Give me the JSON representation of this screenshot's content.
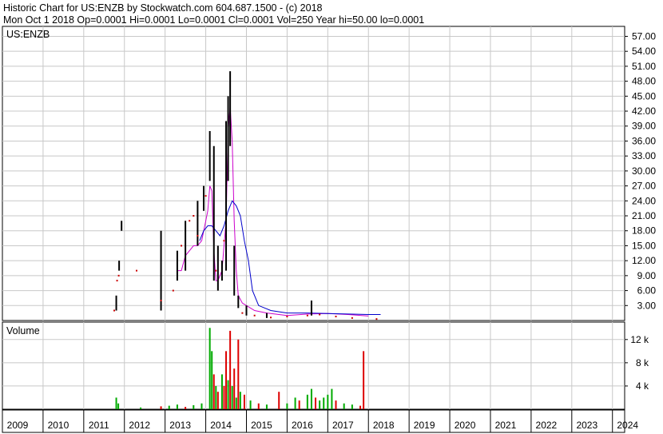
{
  "header": {
    "line1": "Historic Chart for US:ENZB by Stockwatch.com 604.687.1500 - (c) 2018",
    "line2": "Mon Oct  1 2018  Op=0.0001  Hi=0.0001  Lo=0.0001  Cl=0.0001  Vol=250  Year hi=50.00  lo=0.0001"
  },
  "colors": {
    "price_bar": "#000000",
    "up_point": "#cc0000",
    "ma_short": "#cc00cc",
    "ma_long": "#0000cc",
    "volume_up": "#00aa00",
    "volume_down": "#dd0000",
    "grid": "#c8c8c8"
  },
  "chart_data": [
    {
      "type": "line",
      "title": "US:ENZB",
      "xlabel": "",
      "ylabel": "",
      "x_ticks": [
        "2009",
        "2010",
        "2011",
        "2012",
        "2013",
        "2014",
        "2015",
        "2016",
        "2017",
        "2018",
        "2019",
        "2020",
        "2021",
        "2022",
        "2023",
        "2024"
      ],
      "y_ticks": [
        "3.00",
        "6.00",
        "9.00",
        "12.00",
        "15.00",
        "18.00",
        "21.00",
        "24.00",
        "27.00",
        "30.00",
        "33.00",
        "36.00",
        "39.00",
        "42.00",
        "45.00",
        "48.00",
        "51.00",
        "54.00",
        "57.00"
      ],
      "xlim": [
        2009.0,
        2024.3
      ],
      "ylim": [
        0,
        59
      ],
      "grid": true,
      "price_bars": [
        {
          "x": 2011.8,
          "lo": 2.0,
          "hi": 5.0
        },
        {
          "x": 2011.87,
          "lo": 10.0,
          "hi": 12.0
        },
        {
          "x": 2011.93,
          "lo": 18.0,
          "hi": 20.0
        },
        {
          "x": 2012.9,
          "lo": 2.0,
          "hi": 18.0
        },
        {
          "x": 2013.3,
          "lo": 8.0,
          "hi": 14.0
        },
        {
          "x": 2013.5,
          "lo": 10.0,
          "hi": 20.0
        },
        {
          "x": 2013.8,
          "lo": 15.0,
          "hi": 24.0
        },
        {
          "x": 2013.95,
          "lo": 22.0,
          "hi": 27.0
        },
        {
          "x": 2014.1,
          "lo": 28.0,
          "hi": 38.0
        },
        {
          "x": 2014.2,
          "lo": 8.0,
          "hi": 35.0
        },
        {
          "x": 2014.3,
          "lo": 6.0,
          "hi": 15.0
        },
        {
          "x": 2014.4,
          "lo": 8.0,
          "hi": 12.0
        },
        {
          "x": 2014.5,
          "lo": 10.0,
          "hi": 40.0
        },
        {
          "x": 2014.55,
          "lo": 28.0,
          "hi": 45.0
        },
        {
          "x": 2014.6,
          "lo": 35.0,
          "hi": 50.0
        },
        {
          "x": 2014.7,
          "lo": 5.0,
          "hi": 15.0
        },
        {
          "x": 2014.8,
          "lo": 2.5,
          "hi": 5.0
        },
        {
          "x": 2015.0,
          "lo": 1.0,
          "hi": 3.0
        },
        {
          "x": 2015.5,
          "lo": 0.5,
          "hi": 1.5
        },
        {
          "x": 2016.6,
          "lo": 1.0,
          "hi": 4.0
        }
      ],
      "points": [
        {
          "x": 2011.75,
          "y": 2.0
        },
        {
          "x": 2011.82,
          "y": 8.0
        },
        {
          "x": 2011.86,
          "y": 9.0
        },
        {
          "x": 2012.3,
          "y": 10.0
        },
        {
          "x": 2012.9,
          "y": 4.0
        },
        {
          "x": 2013.2,
          "y": 6.0
        },
        {
          "x": 2013.4,
          "y": 15.0
        },
        {
          "x": 2013.6,
          "y": 20.0
        },
        {
          "x": 2013.7,
          "y": 21.0
        },
        {
          "x": 2013.8,
          "y": 17.0
        },
        {
          "x": 2014.0,
          "y": 25.0
        },
        {
          "x": 2014.25,
          "y": 10.0
        },
        {
          "x": 2014.45,
          "y": 16.0
        },
        {
          "x": 2014.9,
          "y": 1.5
        },
        {
          "x": 2015.2,
          "y": 1.0
        },
        {
          "x": 2015.6,
          "y": 0.6
        },
        {
          "x": 2016.0,
          "y": 0.8
        },
        {
          "x": 2016.5,
          "y": 1.0
        },
        {
          "x": 2016.8,
          "y": 1.2
        },
        {
          "x": 2017.2,
          "y": 0.8
        },
        {
          "x": 2017.6,
          "y": 0.5
        },
        {
          "x": 2018.2,
          "y": 0.3
        }
      ],
      "series": [
        {
          "x": [
            2013.3,
            2013.4,
            2013.5,
            2013.6,
            2013.7,
            2013.8,
            2013.9,
            2014.0,
            2014.05,
            2014.1,
            2014.15,
            2014.2,
            2014.25,
            2014.3,
            2014.4,
            2014.5,
            2014.55,
            2014.6,
            2014.65,
            2014.7,
            2014.75,
            2014.8,
            2014.9,
            2015.0,
            2015.2,
            2015.5,
            2016.0,
            2016.5,
            2017.0,
            2017.5,
            2018.0
          ],
          "y": [
            10,
            10,
            13,
            14,
            15,
            15,
            16,
            20,
            22,
            27,
            26,
            14,
            8,
            8,
            10,
            20,
            38,
            43,
            36,
            20,
            10,
            5,
            3.5,
            3,
            2,
            1.5,
            1.0,
            1.3,
            1.4,
            1.2,
            0.9
          ]
        },
        {
          "x": [
            2013.85,
            2013.95,
            2014.05,
            2014.15,
            2014.25,
            2014.35,
            2014.45,
            2014.55,
            2014.65,
            2014.75,
            2014.85,
            2014.95,
            2015.05,
            2015.15,
            2015.3,
            2015.6,
            2016.0,
            2016.5,
            2017.0,
            2017.5,
            2018.0,
            2018.3
          ],
          "y": [
            16,
            18,
            19,
            19,
            18,
            17,
            19,
            22,
            24,
            23,
            21,
            16,
            12,
            6,
            3,
            2,
            1.5,
            1.5,
            1.4,
            1.3,
            1.2,
            1.2
          ]
        }
      ]
    },
    {
      "type": "bar",
      "title": "Volume",
      "xlabel": "",
      "ylabel": "",
      "y_ticks": [
        "4 k",
        "8 k",
        "12 k"
      ],
      "ylim": [
        0,
        15
      ],
      "grid": true,
      "bars": [
        {
          "x": 2011.8,
          "v": 2.0,
          "up": true
        },
        {
          "x": 2011.85,
          "v": 1.0,
          "up": true
        },
        {
          "x": 2012.4,
          "v": 0.3,
          "up": true
        },
        {
          "x": 2012.9,
          "v": 0.5,
          "up": false
        },
        {
          "x": 2013.1,
          "v": 0.6,
          "up": true
        },
        {
          "x": 2013.3,
          "v": 0.8,
          "up": true
        },
        {
          "x": 2013.5,
          "v": 0.4,
          "up": false
        },
        {
          "x": 2013.7,
          "v": 0.7,
          "up": true
        },
        {
          "x": 2013.9,
          "v": 1.0,
          "up": true
        },
        {
          "x": 2014.1,
          "v": 14.0,
          "up": true
        },
        {
          "x": 2014.15,
          "v": 10.0,
          "up": true
        },
        {
          "x": 2014.2,
          "v": 6.0,
          "up": false
        },
        {
          "x": 2014.25,
          "v": 4.0,
          "up": true
        },
        {
          "x": 2014.3,
          "v": 3.0,
          "up": false
        },
        {
          "x": 2014.4,
          "v": 6.0,
          "up": true
        },
        {
          "x": 2014.45,
          "v": 4.0,
          "up": false
        },
        {
          "x": 2014.5,
          "v": 10.0,
          "up": false
        },
        {
          "x": 2014.55,
          "v": 5.0,
          "up": true
        },
        {
          "x": 2014.6,
          "v": 13.5,
          "up": false
        },
        {
          "x": 2014.65,
          "v": 4.0,
          "up": true
        },
        {
          "x": 2014.7,
          "v": 7.0,
          "up": false
        },
        {
          "x": 2014.75,
          "v": 2.0,
          "up": true
        },
        {
          "x": 2014.8,
          "v": 12.0,
          "up": false
        },
        {
          "x": 2014.85,
          "v": 3.0,
          "up": true
        },
        {
          "x": 2014.95,
          "v": 2.5,
          "up": false
        },
        {
          "x": 2015.1,
          "v": 1.5,
          "up": true
        },
        {
          "x": 2015.3,
          "v": 1.0,
          "up": false
        },
        {
          "x": 2015.5,
          "v": 0.8,
          "up": true
        },
        {
          "x": 2015.8,
          "v": 3.0,
          "up": false
        },
        {
          "x": 2016.0,
          "v": 1.0,
          "up": true
        },
        {
          "x": 2016.2,
          "v": 2.0,
          "up": true
        },
        {
          "x": 2016.3,
          "v": 1.5,
          "up": false
        },
        {
          "x": 2016.5,
          "v": 2.5,
          "up": true
        },
        {
          "x": 2016.6,
          "v": 3.5,
          "up": true
        },
        {
          "x": 2016.7,
          "v": 2.0,
          "up": false
        },
        {
          "x": 2016.8,
          "v": 1.5,
          "up": true
        },
        {
          "x": 2016.9,
          "v": 2.0,
          "up": true
        },
        {
          "x": 2017.0,
          "v": 2.5,
          "up": true
        },
        {
          "x": 2017.1,
          "v": 3.5,
          "up": true
        },
        {
          "x": 2017.2,
          "v": 1.5,
          "up": false
        },
        {
          "x": 2017.4,
          "v": 1.0,
          "up": true
        },
        {
          "x": 2017.6,
          "v": 0.8,
          "up": true
        },
        {
          "x": 2017.8,
          "v": 0.6,
          "up": false
        },
        {
          "x": 2017.88,
          "v": 10.0,
          "up": false
        }
      ]
    }
  ]
}
